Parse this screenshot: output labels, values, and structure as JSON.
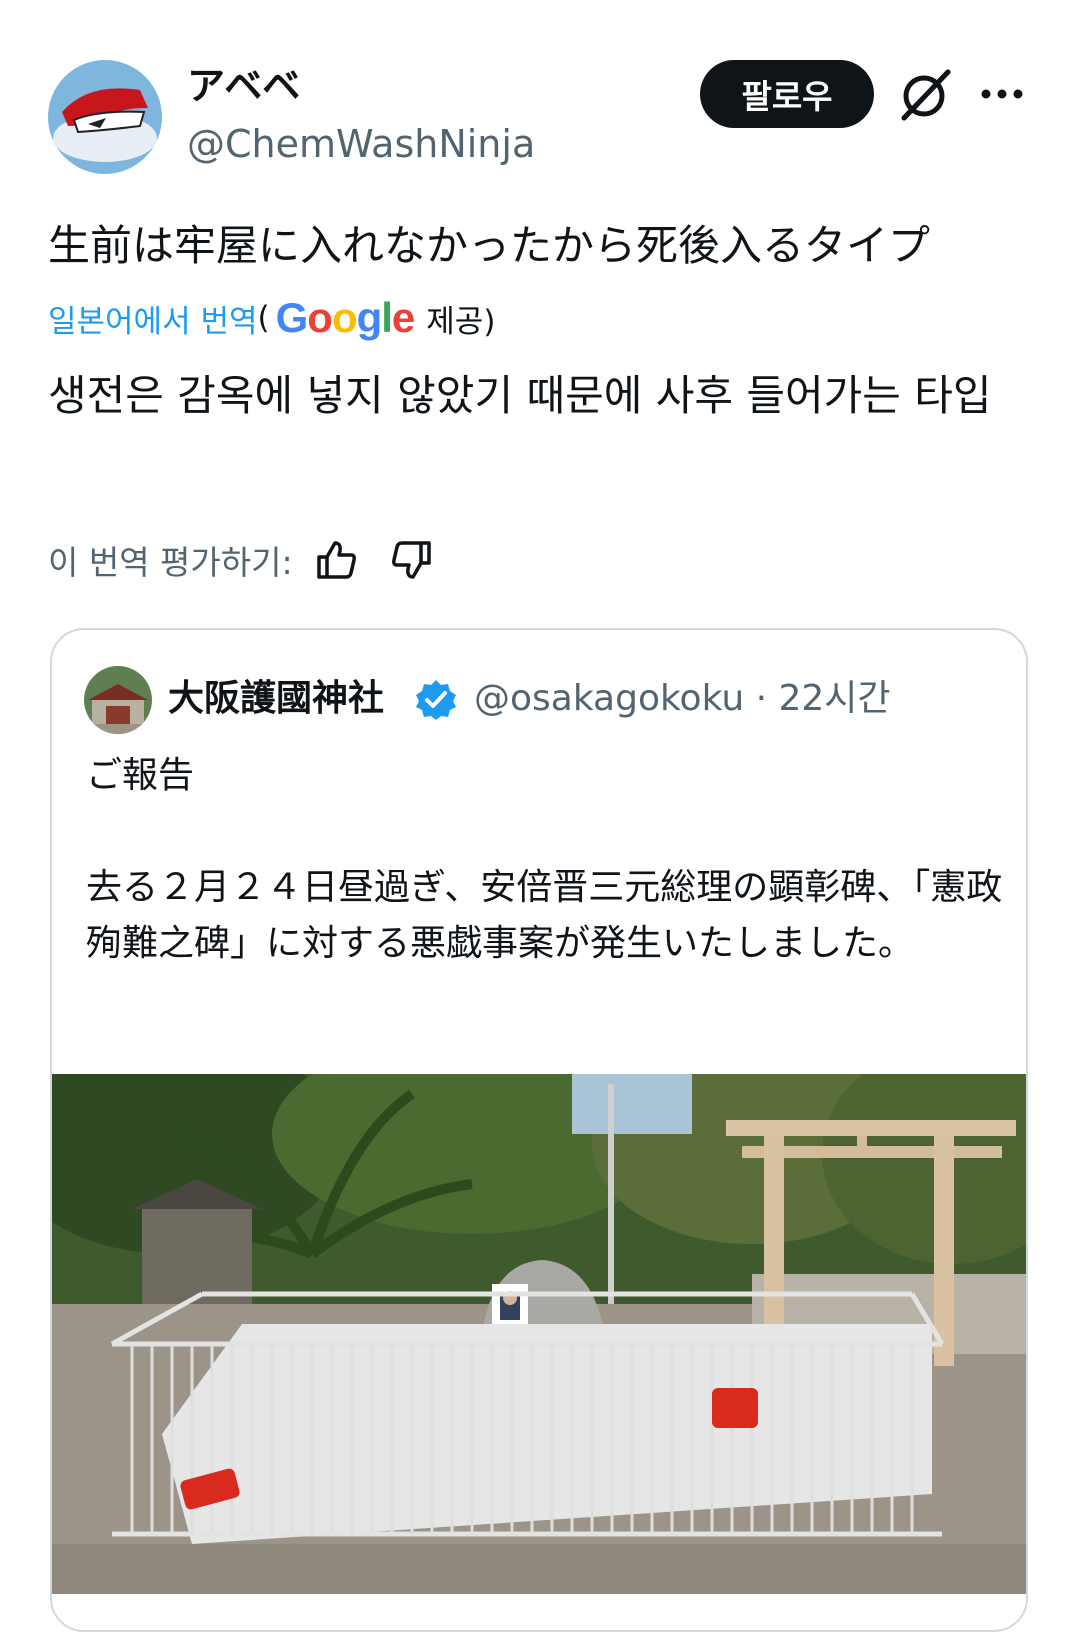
{
  "post": {
    "display_name": "アベベ",
    "handle": "@ChemWashNinja",
    "follow_label": "팔로우",
    "text": "生前は牢屋に入れなかったから死後入るタイプ",
    "translated_from": "일본어에서 번역",
    "paren_open": "(",
    "google": "Google",
    "provided": "제공)",
    "translation": "생전은 감옥에 넣지 않았기 때문에 사후 들어가는 타입",
    "rate_label": "이 번역 평가하기:",
    "icons": {
      "grok": "grok-icon",
      "more": "more-icon",
      "thumbs_up": "thumbs-up-icon",
      "thumbs_down": "thumbs-down-icon"
    }
  },
  "quote": {
    "name": "大阪護國神社",
    "handle_time": "@osakagokoku · 22시간",
    "text": "ご報告\n\n去る２月２４日昼過ぎ、安倍晋三元総理の顕彰碑、「憲政殉難之碑」に対する悪戯事案が発生いたしました。",
    "verified_icon": "verified-badge-icon"
  },
  "colors": {
    "link": "#1d9bf0",
    "muted": "#536471",
    "text": "#0f1419",
    "verified": "#1d9bf0"
  }
}
